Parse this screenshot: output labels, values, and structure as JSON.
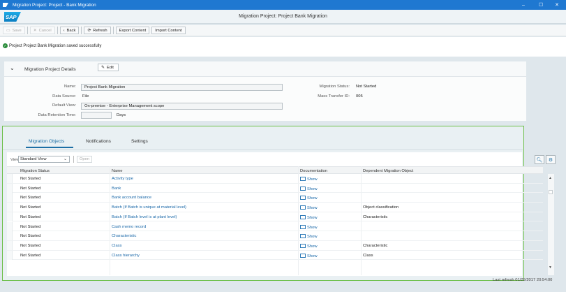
{
  "window": {
    "title": "Migration Project: Project - Bank Migration",
    "min": "–",
    "max": "☐",
    "close": "✕"
  },
  "shell": {
    "logo": "SAP",
    "page_title": "Migration Project: Project Bank Migration"
  },
  "toolbar": {
    "save": "Save",
    "cancel": "Cancel",
    "back": "Back",
    "refresh": "Refresh",
    "export": "Export Content",
    "import": "Import Content"
  },
  "message": {
    "text": "Project Project Bank Migration saved successfully"
  },
  "details": {
    "title": "Migration Project Details",
    "edit": "Edit",
    "name_label": "Name:",
    "name_value": "Project Bank Migration",
    "source_label": "Data Source:",
    "source_value": "File",
    "view_label": "Default View:",
    "view_value": "On-premise - Enterprise Management scope",
    "retention_label": "Data Retention Time:",
    "retention_value": "",
    "retention_unit": "Days",
    "status_label": "Migration Status:",
    "status_value": "Not Started",
    "mass_label": "Mass Transfer ID:",
    "mass_value": "005"
  },
  "tabs": [
    {
      "label": "Migration Objects"
    },
    {
      "label": "Notifications"
    },
    {
      "label": "Settings"
    }
  ],
  "table_toolbar": {
    "view_label": "View:",
    "view_value": "Standard View",
    "open": "Open"
  },
  "table": {
    "headers": [
      "Migration Status",
      "Name",
      "Documentation",
      "Dependent Migration Object"
    ],
    "rows": [
      {
        "status": "Not Started",
        "name": "Activity type",
        "doc": "Show",
        "dep": ""
      },
      {
        "status": "Not Started",
        "name": "Bank",
        "doc": "Show",
        "dep": ""
      },
      {
        "status": "Not Started",
        "name": "Bank account balance",
        "doc": "Show",
        "dep": ""
      },
      {
        "status": "Not Started",
        "name": "Batch (If Batch is unique at material level)",
        "doc": "Show",
        "dep": "Object classification"
      },
      {
        "status": "Not Started",
        "name": "Batch (If Batch level is at plant level)",
        "doc": "Show",
        "dep": "Characteristic"
      },
      {
        "status": "Not Started",
        "name": "Cash memo record",
        "doc": "Show",
        "dep": ""
      },
      {
        "status": "Not Started",
        "name": "Characteristic",
        "doc": "Show",
        "dep": ""
      },
      {
        "status": "Not Started",
        "name": "Class",
        "doc": "Show",
        "dep": "Characteristic"
      },
      {
        "status": "Not Started",
        "name": "Class hierarchy",
        "doc": "Show",
        "dep": "Class"
      }
    ]
  },
  "footer": {
    "last_refresh": "Last refresh 01/25/2017 20:54:00"
  },
  "colors": {
    "accent": "#1d6fa5",
    "titlebar": "#1f78d1",
    "highlight_border": "#6dbf4a",
    "success": "#2a8c3a"
  }
}
